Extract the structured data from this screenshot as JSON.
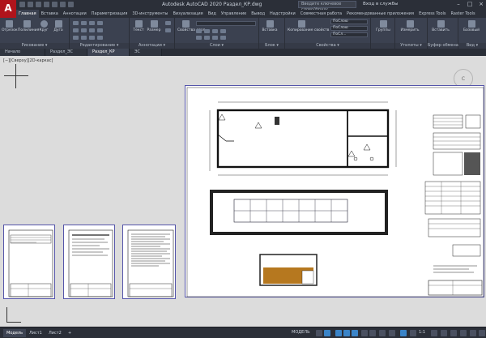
{
  "window": {
    "title": "Autodesk AutoCAD 2020  Раздел_КР.dwg",
    "search_placeholder": "Введите ключевое слово/фразу",
    "signin": "Вход в службы",
    "logo_letter": "A"
  },
  "ribbon_tabs": [
    "Главная",
    "Вставка",
    "Аннотации",
    "Параметризация",
    "3D-инструменты",
    "Визуализация",
    "Вид",
    "Управление",
    "Вывод",
    "Надстройки",
    "Совместная работа",
    "Рекомендованные приложения",
    "Express Tools",
    "Raster Tools"
  ],
  "ribbon": {
    "draw": {
      "label": "Рисование ▾",
      "buttons": [
        "Отрезок",
        "Полилиния",
        "Круг",
        "Дуга"
      ]
    },
    "modify": {
      "label": "Редактирование ▾"
    },
    "annotation": {
      "label": "Аннотации ▾",
      "buttons": [
        "Текст",
        "Размер"
      ]
    },
    "layers": {
      "label": "Слои ▾",
      "buttons": [
        "Свойства слоя"
      ]
    },
    "block": {
      "label": "Блок ▾",
      "buttons": [
        "Вставка"
      ]
    },
    "properties": {
      "label": "Свойства ▾",
      "buttons": [
        "Копирование свойств"
      ],
      "combos": [
        "ПоСлою",
        "ПоСлою",
        "ПоСл..."
      ]
    },
    "groups": {
      "label": "",
      "buttons": [
        "Группы"
      ]
    },
    "utilities": {
      "label": "Утилиты ▾",
      "buttons": [
        "Измерить"
      ]
    },
    "clipboard": {
      "label": "Буфер обмена",
      "buttons": [
        "Вставить"
      ]
    },
    "view": {
      "label": "Вид ▾",
      "buttons": [
        "Базовый"
      ]
    }
  },
  "file_tabs": [
    "Начало",
    "Раздел_ЭС",
    "Раздел_КР",
    "ЭС"
  ],
  "active_file_tab": 2,
  "canvas": {
    "view_label": "[−][Сверху][2D-каркас]",
    "viewcube_label": "С"
  },
  "layout_tabs": [
    "Модель",
    "Лист1",
    "Лист2",
    "+"
  ],
  "status": {
    "model": "МОДЕЛЬ",
    "scale": "1:1"
  },
  "colors": {
    "accent": "#3a84c8",
    "logo": "#b0141c"
  }
}
